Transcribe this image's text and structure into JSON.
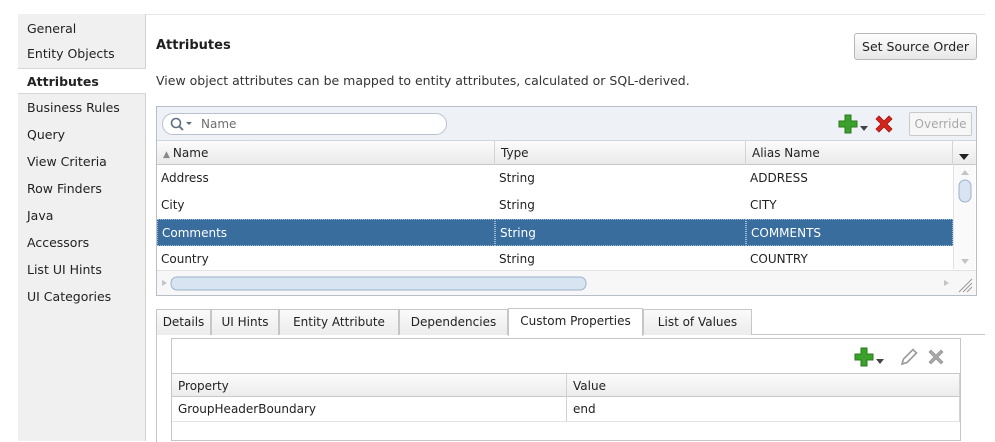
{
  "nav": {
    "items": [
      {
        "label": "General"
      },
      {
        "label": "Entity Objects"
      },
      {
        "label": "Attributes",
        "active": true
      },
      {
        "label": "Business Rules"
      },
      {
        "label": "Query"
      },
      {
        "label": "View Criteria"
      },
      {
        "label": "Row Finders"
      },
      {
        "label": "Java"
      },
      {
        "label": "Accessors"
      },
      {
        "label": "List UI Hints"
      },
      {
        "label": "UI Categories"
      }
    ]
  },
  "main": {
    "title": "Attributes",
    "set_source_order": "Set Source Order",
    "description": "View object attributes can be mapped to entity attributes, calculated or SQL-derived."
  },
  "attributes": {
    "search_placeholder": "Name",
    "override_label": "Override",
    "columns": [
      "Name",
      "Type",
      "Alias Name"
    ],
    "sort_indicator": "▲",
    "rows": [
      {
        "name": "Address",
        "type": "String",
        "alias": "ADDRESS"
      },
      {
        "name": "City",
        "type": "String",
        "alias": "CITY"
      },
      {
        "name": "Comments",
        "type": "String",
        "alias": "COMMENTS",
        "selected": true
      },
      {
        "name": "Country",
        "type": "String",
        "alias": "COUNTRY"
      }
    ]
  },
  "tabs": {
    "items": [
      "Details",
      "UI Hints",
      "Entity Attribute",
      "Dependencies",
      "Custom Properties",
      "List of Values"
    ],
    "active": "Custom Properties"
  },
  "custom_properties": {
    "columns": [
      "Property",
      "Value"
    ],
    "rows": [
      {
        "property": "GroupHeaderBoundary",
        "value": "end"
      }
    ]
  },
  "icons": {
    "add": "plus-icon",
    "delete": "delete-icon",
    "edit": "pencil-icon",
    "search": "search-icon"
  },
  "colors": {
    "selection": "#386d9e",
    "add_green": "#3aa12b",
    "delete_red": "#d4241b"
  }
}
